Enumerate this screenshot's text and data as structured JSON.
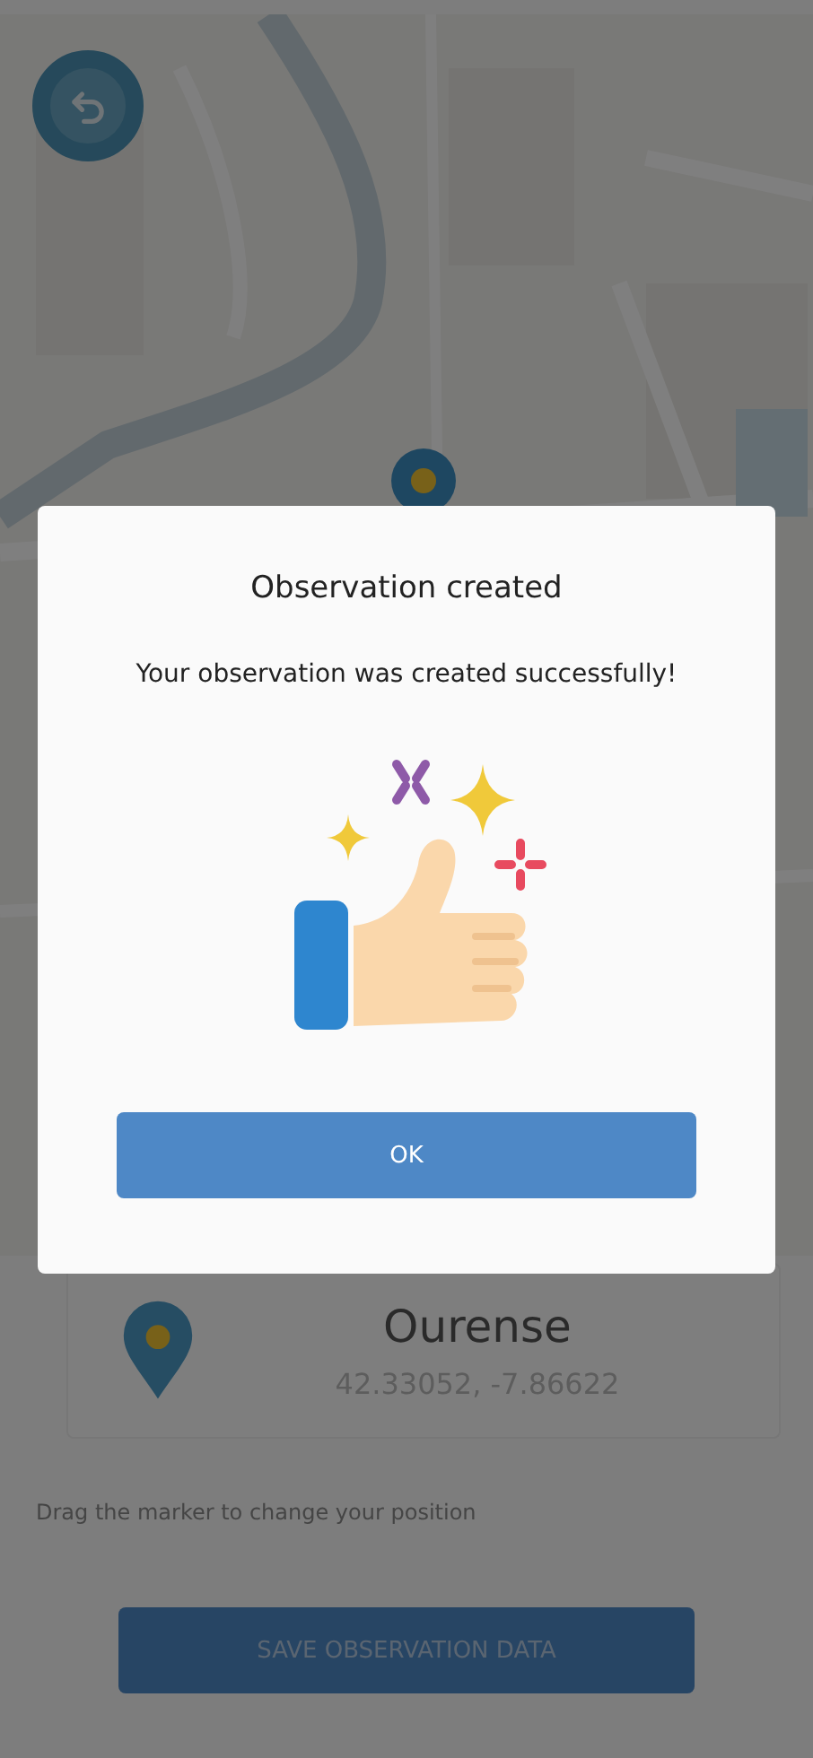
{
  "location": {
    "city": "Ourense",
    "coordinates": "42.33052, -7.86622"
  },
  "hint": "Drag the marker to change your position",
  "save_button": {
    "label": "SAVE OBSERVATION DATA"
  },
  "dialog": {
    "title": "Observation created",
    "message": "Your observation was created successfully!",
    "button": "OK"
  }
}
